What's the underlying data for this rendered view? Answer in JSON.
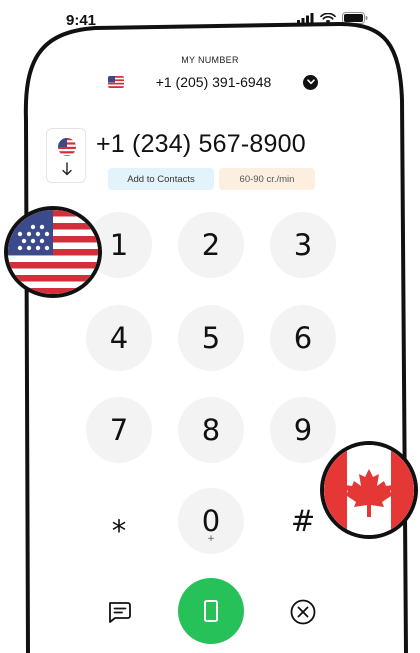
{
  "status_bar": {
    "time": "9:41"
  },
  "header": {
    "label": "MY NUMBER",
    "number": "+1 (205) 391-6948"
  },
  "dialer": {
    "dialed_number": "+1 (234) 567-8900",
    "add_to_contacts": "Add to Contacts",
    "rate": "60-90 cr./min"
  },
  "keypad": {
    "keys": [
      {
        "digit": "1",
        "sub": ""
      },
      {
        "digit": "2",
        "sub": ""
      },
      {
        "digit": "3",
        "sub": ""
      },
      {
        "digit": "4",
        "sub": ""
      },
      {
        "digit": "5",
        "sub": ""
      },
      {
        "digit": "6",
        "sub": ""
      },
      {
        "digit": "7",
        "sub": ""
      },
      {
        "digit": "8",
        "sub": ""
      },
      {
        "digit": "9",
        "sub": ""
      },
      {
        "digit": "*",
        "sub": ""
      },
      {
        "digit": "0",
        "sub": "+"
      },
      {
        "digit": "#",
        "sub": ""
      }
    ]
  },
  "icons": {
    "signal": "signal-icon",
    "wifi": "wifi-icon",
    "battery": "battery-icon",
    "message": "message-icon",
    "call": "phone-icon",
    "clear": "close-circle-icon",
    "chevron": "chevron-down-icon",
    "arrow": "arrow-down-icon"
  },
  "colors": {
    "call_green": "#27c15a",
    "key_bg": "#f3f3f3",
    "contacts_tag_bg": "#e2f3fb",
    "rate_tag_bg": "#fcefe0",
    "us_red": "#d22f3b",
    "us_blue": "#3b4a8a",
    "canada_red": "#e63737"
  }
}
